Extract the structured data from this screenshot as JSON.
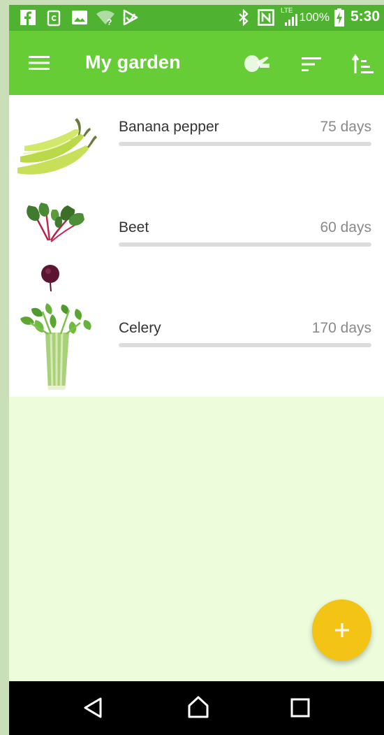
{
  "status_bar": {
    "battery_text": "100%",
    "time": "5:30",
    "network_label": "LTE",
    "icons": [
      "facebook-icon",
      "clipboard-icon",
      "image-icon",
      "wifi-question-icon",
      "play-store-icon",
      "bluetooth-icon",
      "nfc-icon",
      "signal-icon",
      "battery-charging-icon"
    ]
  },
  "app_bar": {
    "title": "My garden",
    "icons": [
      "menu-icon",
      "watering-can-icon",
      "sort-icon",
      "sort-ascending-icon"
    ]
  },
  "plants": [
    {
      "name": "Banana pepper",
      "days": "75 days",
      "progress": 0,
      "image": "banana-pepper-image"
    },
    {
      "name": "Beet",
      "days": "60 days",
      "progress": 0,
      "image": "beet-image"
    },
    {
      "name": "Celery",
      "days": "170 days",
      "progress": 0,
      "image": "celery-image"
    }
  ],
  "fab": {
    "icon": "plus-icon"
  },
  "nav_bar": {
    "icons": [
      "back-icon",
      "home-icon",
      "recents-icon"
    ]
  },
  "colors": {
    "status_bar": "#4fb231",
    "app_bar": "#66cd36",
    "background": "#edfddc",
    "fab": "#f3c316",
    "progress_track": "#dcdcdc"
  }
}
